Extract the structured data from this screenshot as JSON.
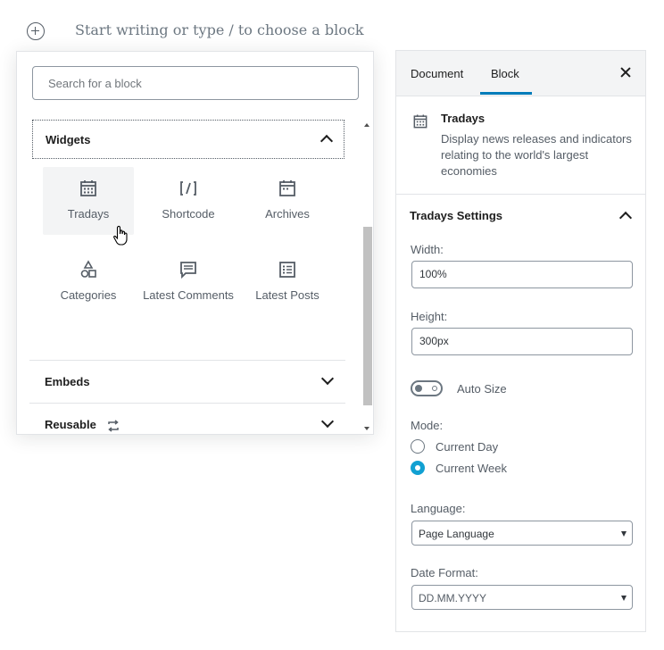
{
  "editor": {
    "placeholder": "Start writing or type / to choose a block"
  },
  "inserter": {
    "search_placeholder": "Search for a block",
    "widgets_title": "Widgets",
    "blocks": [
      {
        "label": "Tradays",
        "icon": "calendar-icon"
      },
      {
        "label": "Shortcode",
        "icon": "shortcode-icon"
      },
      {
        "label": "Archives",
        "icon": "archive-calendar-icon"
      },
      {
        "label": "Categories",
        "icon": "categories-icon"
      },
      {
        "label": "Latest Comments",
        "icon": "comments-icon"
      },
      {
        "label": "Latest Posts",
        "icon": "posts-list-icon"
      }
    ],
    "embeds_title": "Embeds",
    "reusable_title": "Reusable"
  },
  "sidebar": {
    "tabs": [
      "Document",
      "Block"
    ],
    "active_tab": "Block",
    "card": {
      "title": "Tradays",
      "description": "Display news releases and indicators relating to the world's largest economies"
    },
    "settings_title": "Tradays Settings",
    "width_label": "Width:",
    "width_value": "100%",
    "height_label": "Height:",
    "height_value": "300px",
    "autosize_label": "Auto Size",
    "autosize_on": false,
    "mode_label": "Mode:",
    "mode_options": [
      "Current Day",
      "Current Week"
    ],
    "mode_selected": "Current Week",
    "language_label": "Language:",
    "language_value": "Page Language",
    "date_format_label": "Date Format:",
    "date_format_value": "DD.MM.YYYY"
  },
  "colors": {
    "accent": "#007cba",
    "radio_checked": "#11a0d2",
    "text_muted": "#555d66"
  }
}
